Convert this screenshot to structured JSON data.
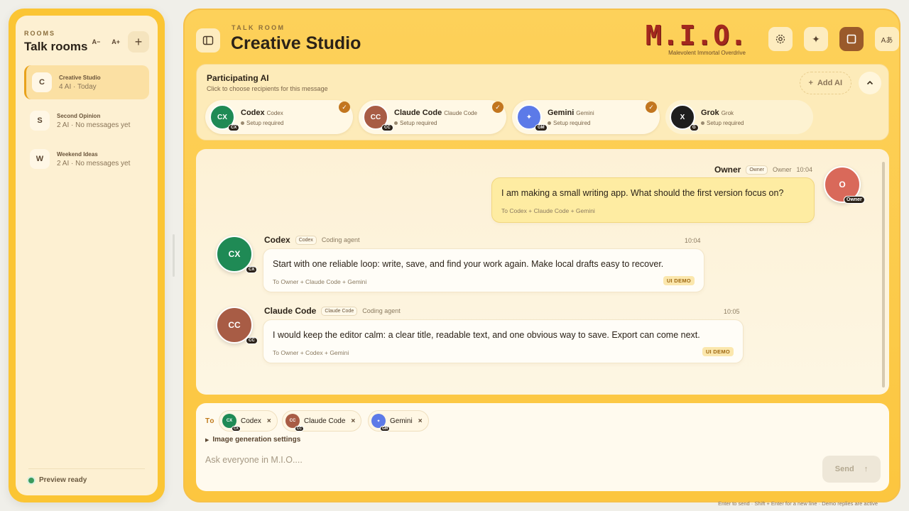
{
  "sidebar": {
    "eyebrow": "ROOMS",
    "title": "Talk rooms",
    "font_decrease": "A−",
    "font_increase": "A+",
    "add_room": "+",
    "rooms": [
      {
        "initial": "C",
        "name": "Creative Studio",
        "meta": "4 AI · Today",
        "active": true
      },
      {
        "initial": "S",
        "name": "Second Opinion",
        "meta": "2 AI · No messages yet",
        "active": false
      },
      {
        "initial": "W",
        "name": "Weekend Ideas",
        "meta": "2 AI · No messages yet",
        "active": false
      }
    ],
    "footer_status": "Preview ready"
  },
  "header": {
    "eyebrow": "TALK ROOM",
    "title": "Creative Studio",
    "brand": "M.I.O.",
    "brand_sub": "Malevolent Immortal Overdrive",
    "lang_label": "Aあ"
  },
  "participants": {
    "title": "Participating AI",
    "subtitle": "Click to choose recipients for this message",
    "add_label": "Add AI",
    "agents": [
      {
        "initials": "CX",
        "name": "Codex",
        "sub": "Codex",
        "status": "Setup required",
        "badge": "CX",
        "color": "#1f8a55",
        "checked": true
      },
      {
        "initials": "CC",
        "name": "Claude Code",
        "sub": "Claude Code",
        "status": "Setup required",
        "badge": "CC",
        "color": "#a85c45",
        "checked": true
      },
      {
        "initials": "✦",
        "name": "Gemini",
        "sub": "Gemini",
        "status": "Setup required",
        "badge": "GM",
        "color": "#5c7ae8",
        "checked": true
      },
      {
        "initials": "X",
        "name": "Grok",
        "sub": "Grok",
        "status": "Setup required",
        "badge": "G",
        "color": "#1e1e1e",
        "checked": false
      }
    ]
  },
  "messages": [
    {
      "author": "Owner",
      "role": "Owner",
      "desc": "Owner",
      "time": "10:04",
      "text": "I am making a small writing app. What should the first version focus on?",
      "to": "To Codex + Claude Code + Gemini",
      "avatar_initial": "O",
      "avatar_badge": "Owner"
    },
    {
      "author": "Codex",
      "role": "Codex",
      "desc": "Coding agent",
      "time": "10:04",
      "text": "Start with one reliable loop: write, save, and find your work again. Make local drafts easy to recover.",
      "to": "To Owner + Claude Code + Gemini",
      "tag": "UI DEMO",
      "avatar_initial": "CX",
      "avatar_badge": "CX"
    },
    {
      "author": "Claude Code",
      "role": "Claude Code",
      "desc": "Coding agent",
      "time": "10:05",
      "text": "I would keep the editor calm: a clear title, readable text, and one obvious way to save. Export can come next.",
      "to": "To Owner + Codex + Gemini",
      "tag": "UI DEMO",
      "avatar_initial": "CC",
      "avatar_badge": "CC"
    }
  ],
  "composer": {
    "to_label": "To",
    "recipients": [
      {
        "initials": "CX",
        "badge": "CX",
        "label": "Codex",
        "color": "#1f8a55"
      },
      {
        "initials": "CC",
        "badge": "CC",
        "label": "Claude Code",
        "color": "#a85c45"
      },
      {
        "initials": "✦",
        "badge": "GM",
        "label": "Gemini",
        "color": "#5c7ae8"
      }
    ],
    "remove_glyph": "×",
    "image_settings": "Image generation settings",
    "placeholder": "Ask everyone in M.I.O....",
    "send_label": "Send",
    "hint": "Enter to send · Shift + Enter for a new line · Demo replies are active"
  }
}
